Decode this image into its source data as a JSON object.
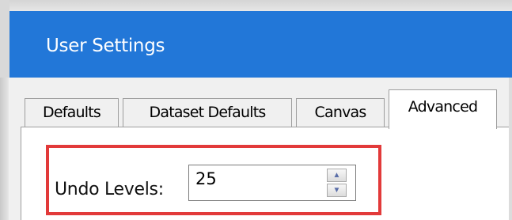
{
  "window": {
    "title": "User Settings"
  },
  "tabs": [
    {
      "label": "Defaults",
      "selected": false
    },
    {
      "label": "Dataset Defaults",
      "selected": false
    },
    {
      "label": "Canvas",
      "selected": false
    },
    {
      "label": "Advanced",
      "selected": true
    }
  ],
  "advanced": {
    "undo_levels_label": "Undo Levels:",
    "undo_levels_value": "25"
  },
  "colors": {
    "title_bar": "#2277d8",
    "highlight": "#e23a3a"
  },
  "icons": {
    "spin_up": "triangle-up-icon",
    "spin_down": "triangle-down-icon"
  }
}
